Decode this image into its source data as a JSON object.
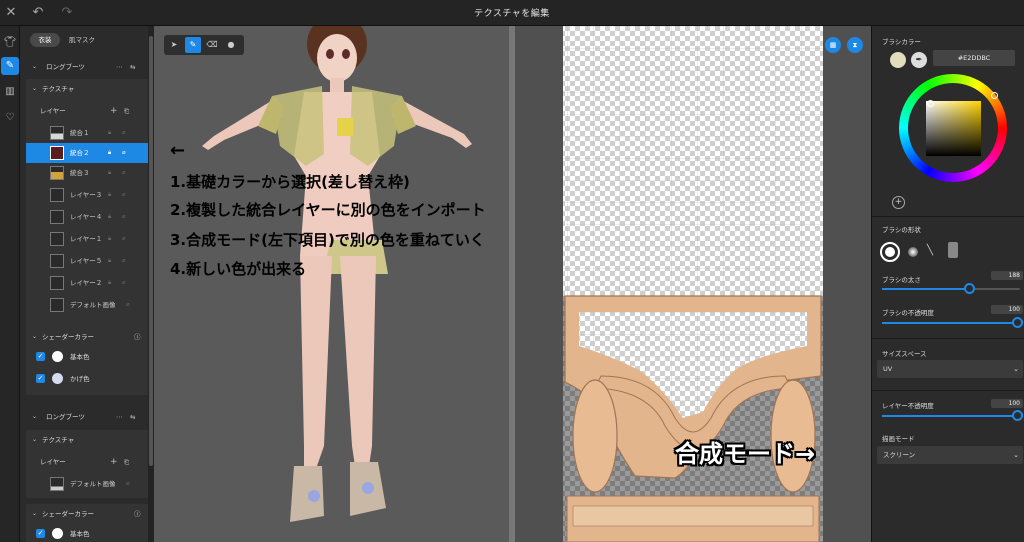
{
  "window": {
    "title": "テクスチャを編集"
  },
  "titlebar_icons": {
    "close": "close-icon",
    "undo": "undo-icon",
    "redo": "redo-icon"
  },
  "rail": {
    "items": [
      "shirt-icon",
      "brush-icon",
      "pants-icon",
      "shield-icon"
    ]
  },
  "left_panel": {
    "tabs": [
      "衣装",
      "肌マスク"
    ],
    "groups": [
      {
        "title": "ロングブーツ",
        "texture_title": "テクスチャ",
        "layers_label": "レイヤー",
        "layers": [
          "統合１",
          "統合２",
          "統合３",
          "レイヤー３",
          "レイヤー４",
          "レイヤー１",
          "レイヤー５",
          "レイヤー２",
          "デフォルト画像"
        ],
        "shader_title": "シェーダーカラー",
        "shader_items": [
          "基本色",
          "かげ色"
        ]
      },
      {
        "title": "ロングブーツ",
        "texture_title": "テクスチャ",
        "layers_label": "レイヤー",
        "layers": [
          "デフォルト画像"
        ],
        "shader_title": "シェーダーカラー",
        "shader_items": [
          "基本色"
        ]
      }
    ]
  },
  "annotations": {
    "arrow": "←",
    "lines": [
      "1.基礎カラーから選択(差し替え枠)",
      "2.複製した統合レイヤーに別の色をインポート",
      "3.合成モード(左下項目)で別の色を重ねていく",
      "4.新しい色が出来る"
    ],
    "blend_note": "合成モード→"
  },
  "right_panel": {
    "brush_color_label": "ブラシカラー",
    "hex": "#E2DDBC",
    "brush_shape_label": "ブラシの形状",
    "brush_size_label": "ブラシの太さ",
    "brush_size_value": "188",
    "brush_opacity_label": "ブラシの不透明度",
    "brush_opacity_value": "100",
    "size_space_label": "サイズスペース",
    "size_space_value": "UV",
    "layer_opacity_label": "レイヤー不透明度",
    "layer_opacity_value": "100",
    "blend_mode_label": "描画モード",
    "blend_mode_value": "スクリーン"
  },
  "colors": {
    "accent": "#1e88e5",
    "brush": "#E2DDBC",
    "skin": "#e8c4b6",
    "lace": "#c8c27a"
  }
}
